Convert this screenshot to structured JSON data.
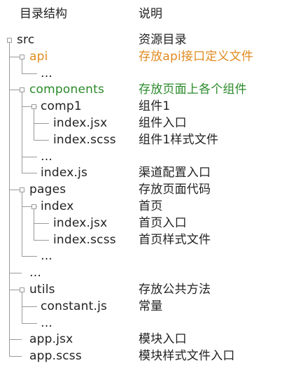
{
  "header": {
    "structure": "目录结构",
    "description": "说明"
  },
  "colors": {
    "orange": "#e08a1e",
    "green": "#2a8a2a",
    "black": "#222222"
  },
  "rows": [
    {
      "name": "src",
      "desc": "资源目录",
      "color": "black"
    },
    {
      "name": "api",
      "desc": "存放api接口定义文件",
      "color": "orange"
    },
    {
      "name": "…",
      "desc": "",
      "color": "black"
    },
    {
      "name": "components",
      "desc": "存放页面上各个组件",
      "color": "green"
    },
    {
      "name": "comp1",
      "desc": "组件1",
      "color": "black"
    },
    {
      "name": "index.jsx",
      "desc": "组件入口",
      "color": "black"
    },
    {
      "name": "index.scss",
      "desc": "组件1样式文件",
      "color": "black"
    },
    {
      "name": "…",
      "desc": "",
      "color": "black"
    },
    {
      "name": "index.js",
      "desc": "渠道配置入口",
      "color": "black"
    },
    {
      "name": "pages",
      "desc": "存放页面代码",
      "color": "black"
    },
    {
      "name": "index",
      "desc": "首页",
      "color": "black"
    },
    {
      "name": "index.jsx",
      "desc": "首页入口",
      "color": "black"
    },
    {
      "name": "index.scss",
      "desc": "首页样式文件",
      "color": "black"
    },
    {
      "name": "…",
      "desc": "",
      "color": "black"
    },
    {
      "name": "…",
      "desc": "",
      "color": "black"
    },
    {
      "name": "utils",
      "desc": "存放公共方法",
      "color": "black"
    },
    {
      "name": "constant.js",
      "desc": "常量",
      "color": "black"
    },
    {
      "name": "…",
      "desc": "",
      "color": "black"
    },
    {
      "name": "app.jsx",
      "desc": "模块入口",
      "color": "black"
    },
    {
      "name": "app.scss",
      "desc": "模块样式文件入口",
      "color": "black"
    }
  ]
}
